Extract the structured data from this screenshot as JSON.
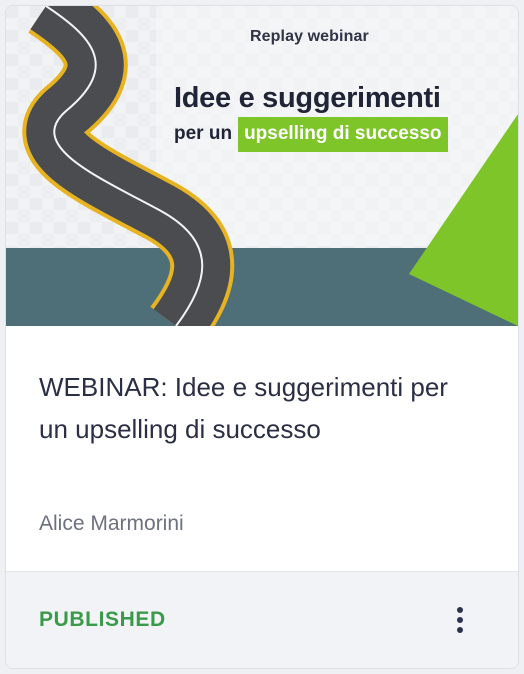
{
  "thumbnail": {
    "kicker": "Replay webinar",
    "headline": "Idee e suggerimenti",
    "subline_prefix": "per un",
    "subline_highlight": "upselling di successo",
    "accent_color": "#7ec529",
    "band_color": "#4f6f78"
  },
  "card": {
    "title": "WEBINAR: Idee e suggerimenti per un upselling di successo",
    "author": "Alice Marmorini",
    "status": "PUBLISHED",
    "status_color": "#3a9a4a",
    "menu_icon": "more-vertical-icon"
  }
}
